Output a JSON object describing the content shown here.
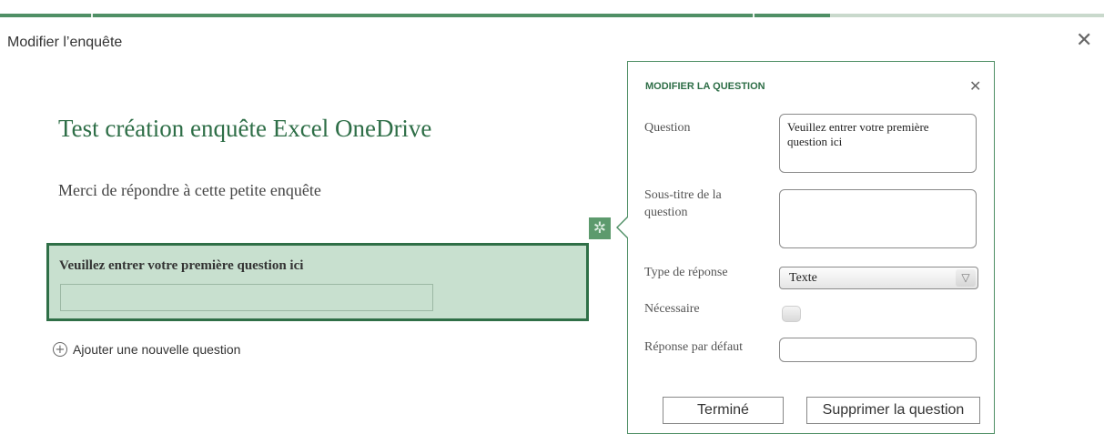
{
  "header": {
    "dialog_title": "Modifier l’enquête",
    "close_glyph": "✕"
  },
  "survey": {
    "title": "Test création enquête Excel OneDrive",
    "subtitle": "Merci de répondre à cette petite enquête",
    "question_label": "Veuillez entrer votre première question ici",
    "add_question_label": "Ajouter une nouvelle question",
    "add_icon_glyph": "+",
    "settings_icon_glyph": "✲"
  },
  "edit_panel": {
    "title": "MODIFIER LA QUESTION",
    "close_glyph": "✕",
    "fields": {
      "question_label": "Question",
      "question_value": "Veuillez entrer votre première question ici",
      "subtitle_label": "Sous-titre de la question",
      "subtitle_value": "",
      "answer_type_label": "Type de réponse",
      "answer_type_value": "Texte",
      "dropdown_glyph": "▽",
      "required_label": "Nécessaire",
      "required_checked": false,
      "default_answer_label": "Réponse par défaut",
      "default_answer_value": ""
    },
    "buttons": {
      "done": "Terminé",
      "delete": "Supprimer la question"
    }
  },
  "colors": {
    "accent": "#2e6e47",
    "question_card_bg": "#c8e0cf",
    "progress_fill": "#4f8f65",
    "progress_track": "#c9d9cc"
  }
}
